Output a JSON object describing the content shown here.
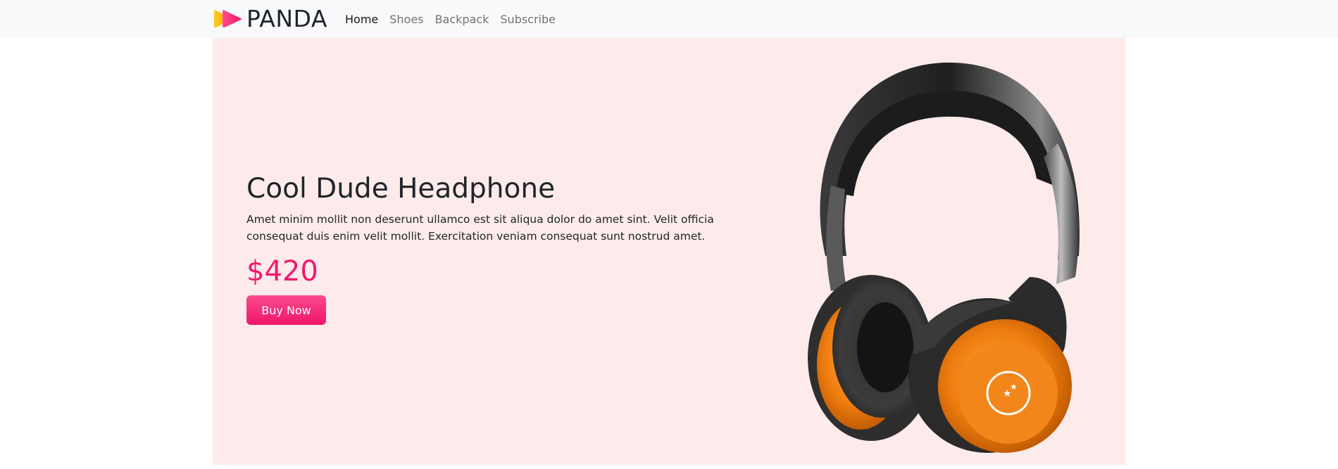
{
  "navbar": {
    "brand": {
      "logo_icon": "panda-play-logo-icon",
      "name": "PANDA"
    },
    "links": [
      {
        "label": "Home",
        "active": true
      },
      {
        "label": "Shoes",
        "active": false
      },
      {
        "label": "Backpack",
        "active": false
      },
      {
        "label": "Subscribe",
        "active": false
      }
    ]
  },
  "hero": {
    "title": "Cool Dude Headphone",
    "description": "Amet minim mollit non deserunt ullamco est sit aliqua dolor do amet sint. Velit officia consequat duis enim velit mollit. Exercitation veniam consequat sunt nostrud amet.",
    "price": "$420",
    "buy_label": "Buy Now",
    "image": "headphone-product-image"
  },
  "colors": {
    "navbar_bg": "#f8f9fa",
    "hero_bg": "#fdebeb",
    "accent": "#f5176c",
    "logo_yellow": "#ffc21a",
    "logo_pink": "#ff2d7a"
  }
}
